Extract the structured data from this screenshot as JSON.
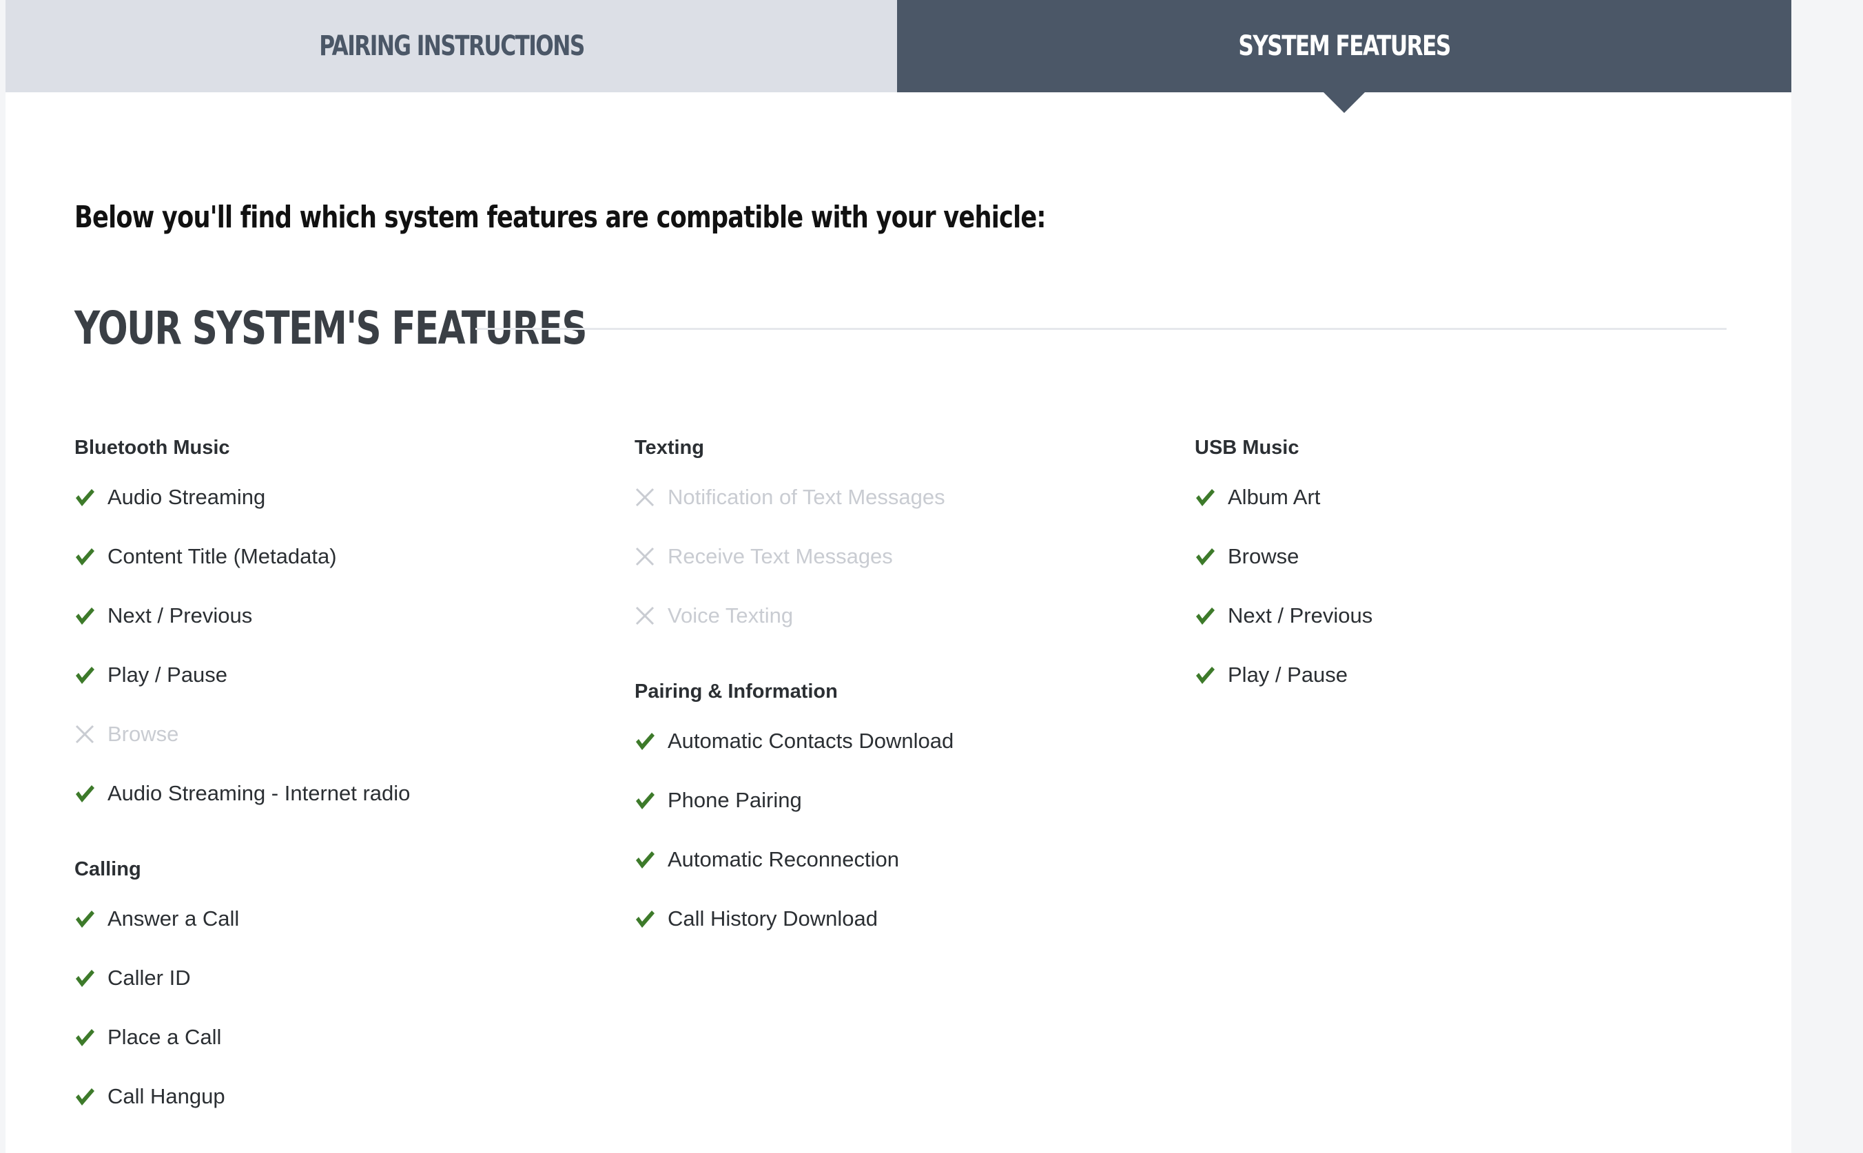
{
  "tabs": [
    {
      "label": "PAIRING INSTRUCTIONS",
      "active": false
    },
    {
      "label": "SYSTEM FEATURES",
      "active": true
    }
  ],
  "intro": "Below you'll find which system features are compatible with your vehicle:",
  "section_title": "YOUR SYSTEM'S FEATURES",
  "colors": {
    "check": "#3d7a2a",
    "cross": "#c9ccd2",
    "tab_active": "#4b5767",
    "tab_inactive": "#dcdfe6"
  },
  "groups": {
    "bluetooth_music": {
      "title": "Bluetooth Music",
      "items": [
        {
          "label": "Audio Streaming",
          "supported": true
        },
        {
          "label": "Content Title (Metadata)",
          "supported": true
        },
        {
          "label": "Next / Previous",
          "supported": true
        },
        {
          "label": "Play / Pause",
          "supported": true
        },
        {
          "label": "Browse",
          "supported": false
        },
        {
          "label": "Audio Streaming - Internet radio",
          "supported": true
        }
      ]
    },
    "calling": {
      "title": "Calling",
      "items": [
        {
          "label": "Answer a Call",
          "supported": true
        },
        {
          "label": "Caller ID",
          "supported": true
        },
        {
          "label": "Place a Call",
          "supported": true
        },
        {
          "label": "Call Hangup",
          "supported": true
        }
      ]
    },
    "texting": {
      "title": "Texting",
      "items": [
        {
          "label": "Notification of Text Messages",
          "supported": false
        },
        {
          "label": "Receive Text Messages",
          "supported": false
        },
        {
          "label": "Voice Texting",
          "supported": false
        }
      ]
    },
    "pairing_information": {
      "title": "Pairing & Information",
      "items": [
        {
          "label": "Automatic Contacts Download",
          "supported": true
        },
        {
          "label": "Phone Pairing",
          "supported": true
        },
        {
          "label": "Automatic Reconnection",
          "supported": true
        },
        {
          "label": "Call History Download",
          "supported": true
        }
      ]
    },
    "usb_music": {
      "title": "USB Music",
      "items": [
        {
          "label": "Album Art",
          "supported": true
        },
        {
          "label": "Browse",
          "supported": true
        },
        {
          "label": "Next / Previous",
          "supported": true
        },
        {
          "label": "Play / Pause",
          "supported": true
        }
      ]
    }
  }
}
